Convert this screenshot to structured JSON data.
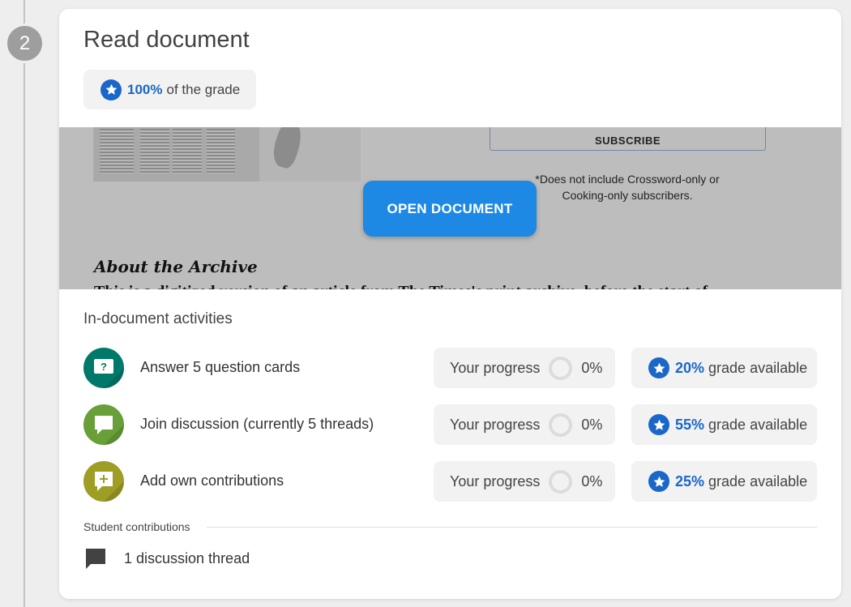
{
  "step": {
    "number": "2"
  },
  "card": {
    "title": "Read document",
    "grade_chip": {
      "percent": "100%",
      "suffix": "of the grade"
    }
  },
  "preview": {
    "subscribe_label": "SUBSCRIBE",
    "disclaimer": "*Does not include Crossword-only or Cooking-only subscribers.",
    "open_button": "OPEN DOCUMENT",
    "archive_heading": "About the Archive",
    "archive_text": "This is a digitized version of an article from The Times's print archive, before the start of"
  },
  "activities": {
    "title": "In-document activities",
    "progress_label": "Your progress",
    "grade_suffix": "grade available",
    "items": [
      {
        "label": "Answer 5 question cards",
        "progress": "0%",
        "grade": "20%",
        "icon": "question-card-icon",
        "color": "#00796b"
      },
      {
        "label": "Join discussion (currently 5 threads)",
        "progress": "0%",
        "grade": "55%",
        "icon": "discussion-icon",
        "color": "#689f38"
      },
      {
        "label": "Add own contributions",
        "progress": "0%",
        "grade": "25%",
        "icon": "add-comment-icon",
        "color": "#9e9d24"
      }
    ]
  },
  "contributions": {
    "title": "Student contributions",
    "thread_label": "1 discussion thread",
    "icon": "comment-icon"
  },
  "colors": {
    "accent": "#1a67c9",
    "button": "#1e88e5"
  }
}
